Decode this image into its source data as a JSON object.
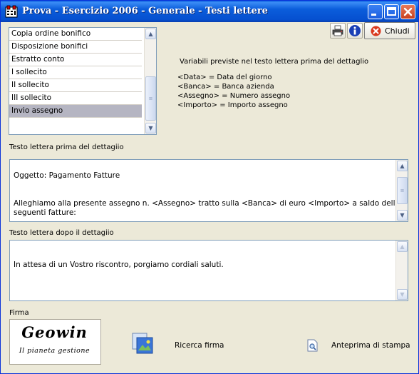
{
  "window": {
    "title": "Prova - Esercizio 2006 - Generale - Testi lettere",
    "controls": {
      "minimize": "minimize",
      "maximize": "maximize",
      "close": "close"
    }
  },
  "toolbar": {
    "print_icon": "printer-icon",
    "info_icon": "info-icon",
    "close_label": "Chiudi"
  },
  "letter_list": {
    "items": [
      {
        "label": "Copia ordine bonifico",
        "selected": false
      },
      {
        "label": "Disposizione bonifici",
        "selected": false
      },
      {
        "label": "Estratto conto",
        "selected": false
      },
      {
        "label": "I sollecito",
        "selected": false
      },
      {
        "label": "II sollecito",
        "selected": false
      },
      {
        "label": "III sollecito",
        "selected": false
      },
      {
        "label": "Invio assegno",
        "selected": true
      }
    ]
  },
  "variables": {
    "heading": "Variabili previste nel testo lettera prima del dettaglio",
    "items": [
      "<Data> = Data del giorno",
      "<Banca> = Banca azienda",
      "<Assegno> = Numero assegno",
      "<Importo> = Importo assegno"
    ]
  },
  "text_before": {
    "label": "Testo lettera prima del dettagiio",
    "lines": [
      "Oggetto: Pagamento Fatture",
      "Alleghiamo alla  presente  assegno  n.  <Assegno>  tratto sulla  <Banca>  di euro  <Importo>  a saldo delle",
      "seguenti fatture:"
    ]
  },
  "text_after": {
    "label": "Testo lettera dopo il dettagiio",
    "lines": [
      "In attesa di un Vostro riscontro, porgiamo cordiali saluti."
    ]
  },
  "signature": {
    "label": "Firma",
    "image_title": "Geowin",
    "image_subtitle": "Il pianeta gestione",
    "search_label": "Ricerca firma",
    "preview_label": "Anteprima di stampa"
  },
  "colors": {
    "title_bar": "#0054e3",
    "window_bg": "#ece9d8",
    "selected_row": "#b5b5c2",
    "close_red": "#d9381e"
  }
}
